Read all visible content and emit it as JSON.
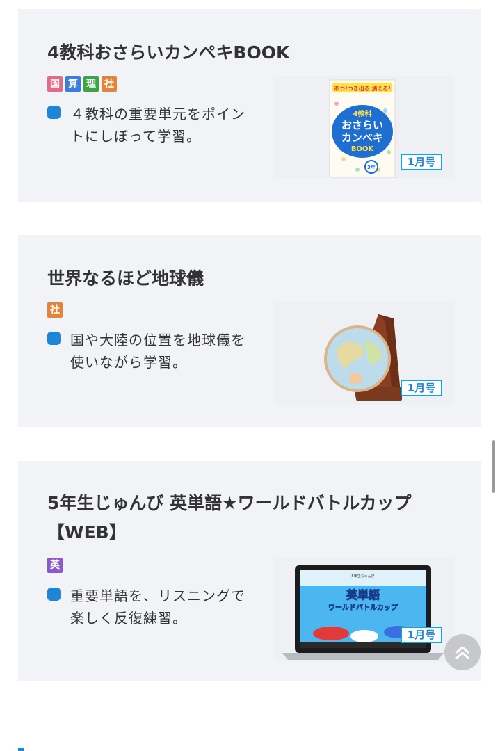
{
  "cards": [
    {
      "title": "4教科おさらいカンペキBOOK",
      "tags": [
        {
          "label": "国",
          "color": "#e8688a"
        },
        {
          "label": "算",
          "color": "#3b7ddb"
        },
        {
          "label": "理",
          "color": "#3aa544"
        },
        {
          "label": "社",
          "color": "#e2843a"
        }
      ],
      "description": "４教科の重要単元をポイントにしぼって学習。",
      "month": "1月号",
      "book": {
        "top_banner": "あつ!つき出る 消える!",
        "line1": "4教科",
        "line2": "おさらい",
        "line3": "カンペキ",
        "line4": "BOOK",
        "grade": "3年"
      }
    },
    {
      "title": "世界なるほど地球儀",
      "tags": [
        {
          "label": "社",
          "color": "#e2843a"
        }
      ],
      "description": "国や大陸の位置を地球儀を使いながら学習。",
      "month": "1月号"
    },
    {
      "title": "5年生じゅんび 英単語★ワールドバトルカップ【WEB】",
      "tags": [
        {
          "label": "英",
          "color": "#8b59c9"
        }
      ],
      "description": "重要単語を、リスニングで楽しく反復練習。",
      "month": "1月号",
      "screen": {
        "small_title": "5年生じゅんび",
        "big_title": "英単語",
        "subtitle": "ワールドバトルカップ"
      }
    }
  ]
}
